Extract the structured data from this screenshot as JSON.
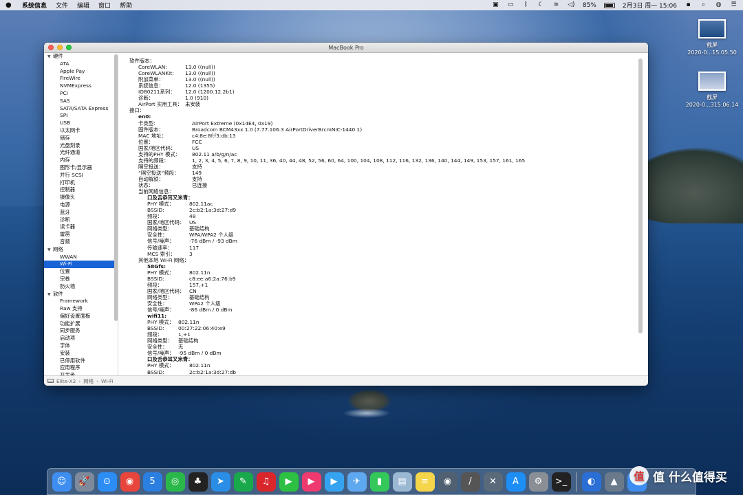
{
  "menubar": {
    "app_name": "系统信息",
    "menus": [
      "文件",
      "编辑",
      "窗口",
      "帮助"
    ],
    "battery": "85%",
    "clock": "2月3日 周一  15:06"
  },
  "desktop_files": [
    {
      "name": "截屏",
      "sub": "2020-0...15.05.50"
    },
    {
      "name": "截屏",
      "sub": "2020-0...315.06.14"
    }
  ],
  "window": {
    "title": "MacBook Pro",
    "breadcrumb": [
      "Elite-X2",
      "网络",
      "Wi-Fi"
    ]
  },
  "sidebar": [
    {
      "label": "硬件",
      "cat": true
    },
    {
      "label": "ATA"
    },
    {
      "label": "Apple Pay"
    },
    {
      "label": "FireWire"
    },
    {
      "label": "NVMExpress"
    },
    {
      "label": "PCI"
    },
    {
      "label": "SAS"
    },
    {
      "label": "SATA/SATA Express"
    },
    {
      "label": "SPI"
    },
    {
      "label": "USB"
    },
    {
      "label": "以太网卡"
    },
    {
      "label": "储存"
    },
    {
      "label": "光盘刻录"
    },
    {
      "label": "光纤通道"
    },
    {
      "label": "内存"
    },
    {
      "label": "图形卡/显示器"
    },
    {
      "label": "并行 SCSI"
    },
    {
      "label": "打印机"
    },
    {
      "label": "控制器"
    },
    {
      "label": "摄像头"
    },
    {
      "label": "电源"
    },
    {
      "label": "蓝牙"
    },
    {
      "label": "诊断"
    },
    {
      "label": "读卡器"
    },
    {
      "label": "雷雳"
    },
    {
      "label": "音频"
    },
    {
      "label": "网络",
      "cat": true
    },
    {
      "label": "WWAN"
    },
    {
      "label": "Wi-Fi",
      "selected": true
    },
    {
      "label": "位置"
    },
    {
      "label": "宗卷"
    },
    {
      "label": "防火墙"
    },
    {
      "label": "软件",
      "cat": true
    },
    {
      "label": "Framework"
    },
    {
      "label": "Raw 支持"
    },
    {
      "label": "偏好设置面板"
    },
    {
      "label": "功能扩展"
    },
    {
      "label": "同步服务"
    },
    {
      "label": "启动项"
    },
    {
      "label": "字体"
    },
    {
      "label": "安装"
    },
    {
      "label": "已停用软件"
    },
    {
      "label": "应用程序"
    },
    {
      "label": "开发者"
    }
  ],
  "content": [
    {
      "k": "软件版本：",
      "lvl": 0
    },
    {
      "k": "CoreWLAN:",
      "v": "13.0 ((null))",
      "lvl": 1
    },
    {
      "k": "CoreWLANKit:",
      "v": "13.0 ((null))",
      "lvl": 1
    },
    {
      "k": "附加菜单：",
      "v": "13.0 ((null))",
      "lvl": 1
    },
    {
      "k": "系统信息：",
      "v": "12.0 (1355)",
      "lvl": 1
    },
    {
      "k": "IO80211系列：",
      "v": "12.0 (1200.12.2b1)",
      "lvl": 1
    },
    {
      "k": "诊断：",
      "v": "1.0 (910)",
      "lvl": 1
    },
    {
      "k": "AirPort 实用工具：",
      "v": "未安装",
      "lvl": 1
    },
    {
      "k": "接口：",
      "lvl": 0
    },
    {
      "k": "en0:",
      "lvl": 1,
      "bold": true
    },
    {
      "k": "卡类型:",
      "v": "AirPort Extreme  (0x14E4, 0x19)",
      "lvl": 2
    },
    {
      "k": "固件版本：",
      "v": "Broadcom BCM43xx 1.0 (7.77.106.3 AirPortDriverBrcmNIC-1440.1)",
      "lvl": 2
    },
    {
      "k": "MAC 地址：",
      "v": "c4:8e:8f:f3:db:13",
      "lvl": 2
    },
    {
      "k": "位置：",
      "v": "FCC",
      "lvl": 2
    },
    {
      "k": "国家/地区代码：",
      "v": "US",
      "lvl": 2
    },
    {
      "k": "支持的PHY 模式：",
      "v": "802.11 a/b/g/n/ac",
      "lvl": 2
    },
    {
      "k": "支持的频段：",
      "v": "1, 2, 3, 4, 5, 6, 7, 8, 9, 10, 11, 36, 40, 44, 48, 52, 56, 60, 64, 100, 104, 108, 112, 116, 132, 136, 140, 144, 149, 153, 157, 161, 165",
      "lvl": 2
    },
    {
      "k": "隔空投送：",
      "v": "支持",
      "lvl": 2
    },
    {
      "k": "“隔空投送”频段：",
      "v": "149",
      "lvl": 2
    },
    {
      "k": "自动解锁：",
      "v": "支持",
      "lvl": 2
    },
    {
      "k": "状态：",
      "v": "已连接",
      "lvl": 2
    },
    {
      "k": "当前网络信息：",
      "lvl": 2
    },
    {
      "k": "口及舌恭耳又米青：",
      "lvl": 3,
      "bold": true
    },
    {
      "k": "PHY 模式：",
      "v": "802.11ac",
      "lvl": 4
    },
    {
      "k": "BSSID:",
      "v": "2c:b2:1a:3d:27:d9",
      "lvl": 4
    },
    {
      "k": "频段：",
      "v": "48",
      "lvl": 4
    },
    {
      "k": "国家/地区代码：",
      "v": "US",
      "lvl": 4
    },
    {
      "k": "网络类型：",
      "v": "基础结构",
      "lvl": 4
    },
    {
      "k": "安全性：",
      "v": "WPA/WPA2 个人级",
      "lvl": 4
    },
    {
      "k": "信号/噪声：",
      "v": "-76 dBm / -93 dBm",
      "lvl": 4
    },
    {
      "k": "传输速率：",
      "v": "117",
      "lvl": 4
    },
    {
      "k": "MCS 索引：",
      "v": "3",
      "lvl": 4
    },
    {
      "k": "其他本地 Wi-Fi 网络：",
      "lvl": 2
    },
    {
      "k": "58Gfs:",
      "lvl": 3,
      "bold": true
    },
    {
      "k": "PHY 模式：",
      "v": "802.11n",
      "lvl": 4
    },
    {
      "k": "BSSID:",
      "v": "c8:ee:a6:2a:76:b9",
      "lvl": 4
    },
    {
      "k": "频段：",
      "v": "157,+1",
      "lvl": 4
    },
    {
      "k": "国家/地区代码：",
      "v": "CN",
      "lvl": 4
    },
    {
      "k": "网络类型：",
      "v": "基础结构",
      "lvl": 4
    },
    {
      "k": "安全性：",
      "v": "WPA2 个人级",
      "lvl": 4
    },
    {
      "k": "信号/噪声：",
      "v": "-86 dBm / 0 dBm",
      "lvl": 4
    },
    {
      "k": "wifi11:",
      "lvl": 3,
      "bold": true
    },
    {
      "k": "PHY 模式：",
      "v": "802.11n",
      "lvl": 5
    },
    {
      "k": "BSSID:",
      "v": "00:27:22:06:40:e9",
      "lvl": 5
    },
    {
      "k": "频段：",
      "v": "1,+1",
      "lvl": 5
    },
    {
      "k": "网络类型：",
      "v": "基础结构",
      "lvl": 5
    },
    {
      "k": "安全性：",
      "v": "无",
      "lvl": 5
    },
    {
      "k": "信号/噪声：",
      "v": "-95 dBm / 0 dBm",
      "lvl": 5
    },
    {
      "k": "口及舌恭耳又米青：",
      "lvl": 3,
      "bold": true
    },
    {
      "k": "PHY 模式：",
      "v": "802.11n",
      "lvl": 4
    },
    {
      "k": "BSSID:",
      "v": "2c:b2:1a:3d:27:db",
      "lvl": 4
    },
    {
      "k": "频段：",
      "v": "11",
      "lvl": 4
    }
  ],
  "dock": [
    {
      "name": "finder",
      "color": "#3d8ef0",
      "glyph": "☺"
    },
    {
      "name": "launchpad",
      "color": "#7d8a9c",
      "glyph": "🚀"
    },
    {
      "name": "safari",
      "color": "#2b8df5",
      "glyph": "⊙"
    },
    {
      "name": "chrome",
      "color": "#e8453c",
      "glyph": "◉"
    },
    {
      "name": "app-5",
      "color": "#2a7fe0",
      "glyph": "5"
    },
    {
      "name": "wechat",
      "color": "#2bb84a",
      "glyph": "◎"
    },
    {
      "name": "qq",
      "color": "#222222",
      "glyph": "♣"
    },
    {
      "name": "app-dingtalk",
      "color": "#2a8de6",
      "glyph": "➤"
    },
    {
      "name": "evernote",
      "color": "#1aa84c",
      "glyph": "✎"
    },
    {
      "name": "netease-music",
      "color": "#d8262b",
      "glyph": "♫"
    },
    {
      "name": "iqiyi",
      "color": "#2dc043",
      "glyph": "▶"
    },
    {
      "name": "youku",
      "color": "#ee3a6e",
      "glyph": "▶"
    },
    {
      "name": "infuse",
      "color": "#35a3f0",
      "glyph": "▶"
    },
    {
      "name": "airmail",
      "color": "#5ea8f0",
      "glyph": "✈"
    },
    {
      "name": "facetime",
      "color": "#34c759",
      "glyph": "▮"
    },
    {
      "name": "preview",
      "color": "#9bb8d3",
      "glyph": "▤"
    },
    {
      "name": "notes",
      "color": "#f5d54a",
      "glyph": "≡"
    },
    {
      "name": "quicktime",
      "color": "#506070",
      "glyph": "◉"
    },
    {
      "name": "instruments",
      "color": "#555555",
      "glyph": "/"
    },
    {
      "name": "utilities",
      "color": "#5a6a7a",
      "glyph": "✕"
    },
    {
      "name": "app-store",
      "color": "#1d8ef5",
      "glyph": "A"
    },
    {
      "name": "system-preferences",
      "color": "#8a8f96",
      "glyph": "⚙"
    },
    {
      "name": "terminal",
      "color": "#222222",
      "glyph": ">_"
    }
  ],
  "dock_right": [
    {
      "name": "recent-app-1",
      "color": "#2b6fd6",
      "glyph": "◐"
    },
    {
      "name": "recent-app-2",
      "color": "#6a7a8a",
      "glyph": "▲"
    },
    {
      "name": "recent-app-3",
      "color": "#3d8ef0",
      "glyph": "◆"
    }
  ],
  "watermark": "值 什么值得买"
}
